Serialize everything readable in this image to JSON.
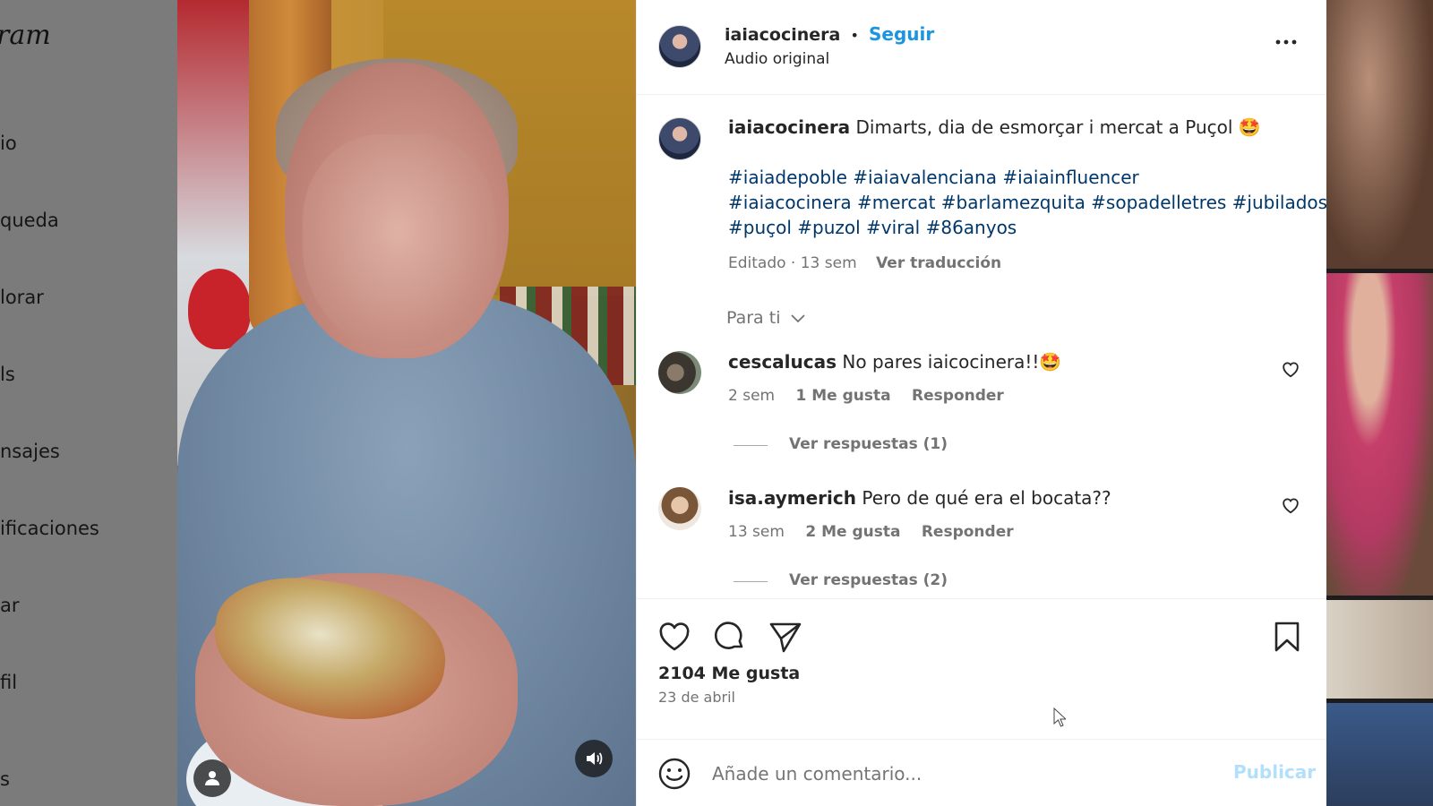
{
  "sidebar": {
    "logo": "ram",
    "items": [
      "io",
      "queda",
      "lorar",
      "ls",
      "nsajes",
      "ificaciones",
      "ar",
      "fil",
      "s"
    ]
  },
  "post": {
    "owner": "iaiacocinera",
    "follow_label": "Seguir",
    "separator": "•",
    "audio": "Audio original",
    "caption": "Dimarts, dia de esmorçar i mercat a Puçol 🤩",
    "hashtags_line1": "#iaiadepoble #iaiavalenciana #iaiainfluencer",
    "hashtags_line2": "#iaiacocinera #mercat #barlamezquita #sopadelletres #jubilados",
    "hashtags_line3": "#puçol #puzol #viral #86anyos",
    "edited": "Editado · 13 sem",
    "translate_label": "Ver traducción",
    "sort_label": "Para ti",
    "likes": "2104 Me gusta",
    "date": "23 de abril",
    "comment_placeholder": "Añade un comentario...",
    "publish_label": "Publicar"
  },
  "comments": [
    {
      "user": "cescalucas",
      "text": "No pares iaicocinera!!🤩",
      "time": "2 sem",
      "likes": "1 Me gusta",
      "reply": "Responder",
      "replies": "Ver respuestas (1)"
    },
    {
      "user": "isa.aymerich",
      "text": "Pero de qué era el bocata??",
      "time": "13 sem",
      "likes": "2 Me gusta",
      "reply": "Responder",
      "replies": "Ver respuestas (2)"
    }
  ],
  "colors": {
    "link": "#00376b",
    "follow": "#1b95e0",
    "muted": "#737373",
    "publish_disabled": "#b2dffc"
  },
  "icons": [
    "user-icon",
    "sound-icon",
    "more-icon",
    "heart-icon",
    "comment-icon",
    "share-icon",
    "save-icon",
    "emoji-icon",
    "chevron-down-icon"
  ]
}
